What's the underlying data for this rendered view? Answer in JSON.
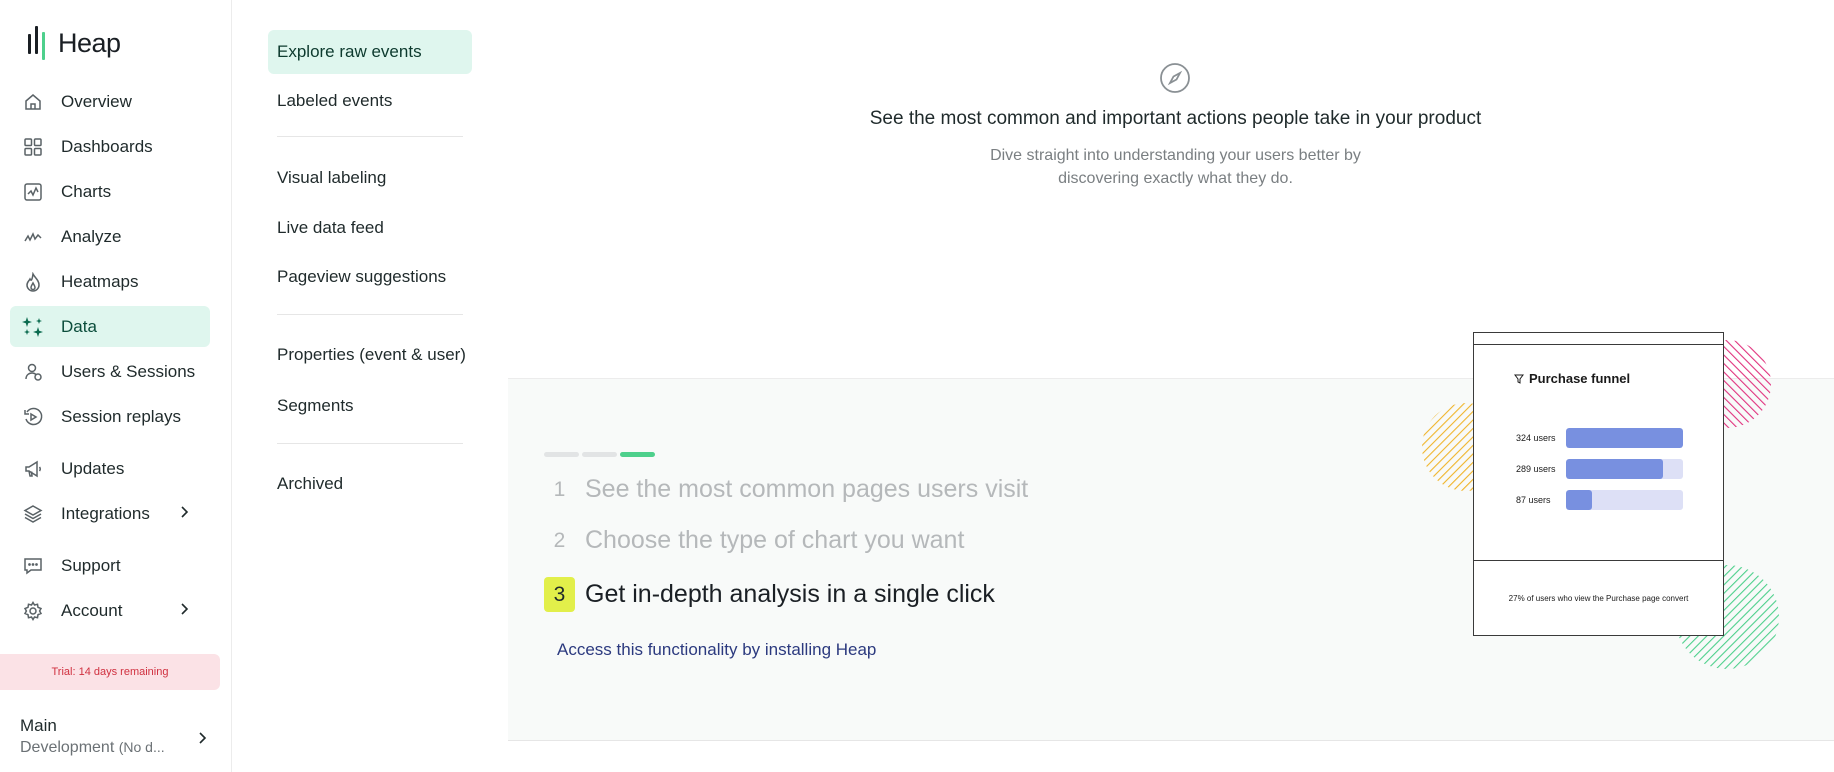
{
  "app": {
    "brand": "Heap"
  },
  "sidebar": {
    "items": [
      {
        "label": "Overview",
        "icon": "home-icon"
      },
      {
        "label": "Dashboards",
        "icon": "dashboards-icon"
      },
      {
        "label": "Charts",
        "icon": "charts-icon"
      },
      {
        "label": "Analyze",
        "icon": "analyze-icon"
      },
      {
        "label": "Heatmaps",
        "icon": "heatmaps-icon"
      },
      {
        "label": "Data",
        "icon": "data-icon",
        "active": true
      },
      {
        "label": "Users & Sessions",
        "icon": "users-icon"
      },
      {
        "label": "Session replays",
        "icon": "replay-icon"
      },
      {
        "label": "Updates",
        "icon": "megaphone-icon"
      },
      {
        "label": "Integrations",
        "icon": "layers-icon"
      },
      {
        "label": "Support",
        "icon": "chat-icon"
      },
      {
        "label": "Account",
        "icon": "gear-icon"
      }
    ],
    "trial": "Trial: 14 days remaining",
    "environment": {
      "main": "Main",
      "sub": "Development",
      "sub_note": "(No d..."
    }
  },
  "submenu": {
    "items": [
      "Explore raw events",
      "Labeled events",
      "Visual labeling",
      "Live data feed",
      "Pageview suggestions",
      "Properties (event & user)",
      "Segments",
      "Archived"
    ]
  },
  "hero": {
    "title": "See the most common and important actions people take in your product",
    "desc_line1": "Dive straight into understanding your users better by",
    "desc_line2": "discovering exactly what they do."
  },
  "steps": {
    "progress_done": 3,
    "progress_total": 3,
    "items": [
      {
        "num": "1",
        "text": "See the most common pages users visit"
      },
      {
        "num": "2",
        "text": "Choose the type of chart you want"
      },
      {
        "num": "3",
        "text": "Get in-depth analysis in a single click"
      }
    ],
    "cta": "Access this functionality by installing Heap"
  },
  "funnel": {
    "title": "Purchase funnel",
    "rows": [
      {
        "label": "324 users",
        "fraction": 1.0
      },
      {
        "label": "289 users",
        "fraction": 0.83
      },
      {
        "label": "87 users",
        "fraction": 0.22
      }
    ],
    "footnote": "27% of users who view the Purchase page convert",
    "colors": {
      "bar": "#7890e0",
      "track": "#dde0f6",
      "accent_pink": "#e0347f",
      "accent_yellow": "#f0b429",
      "accent_green": "#4ed08c"
    }
  },
  "colors": {
    "active_bg": "#dff6ee",
    "brand_green": "#4ed08c",
    "trial_bg": "#fbe2e6",
    "link": "#2c3a7f"
  }
}
